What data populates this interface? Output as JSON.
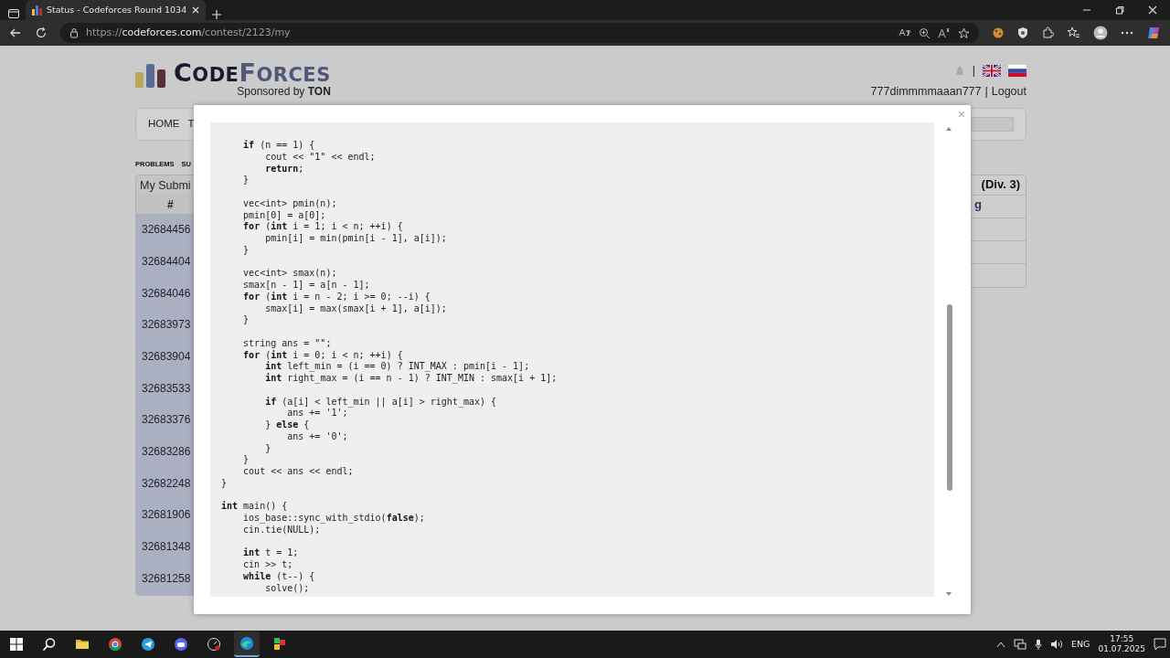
{
  "browser": {
    "tab": {
      "title": "Status - Codeforces Round 1034",
      "selected": true
    },
    "url": {
      "scheme": "https://",
      "host": "codeforces.com",
      "path": "/contest/2123/my"
    }
  },
  "page": {
    "logo": {
      "first": "CODE",
      "second": "FORCES",
      "sponsor": "Sponsored by **TON**"
    },
    "user": {
      "separator": "|",
      "handle": "777dimmmmaaan777",
      "between": "|",
      "logout": "Logout"
    },
    "menu": [
      {
        "label": "HOME"
      },
      {
        "label": "T"
      }
    ],
    "submenu": [
      {
        "label": "PROBLEMS"
      },
      {
        "label": "SU"
      }
    ],
    "submissions": {
      "title": "My Submi",
      "header": "#",
      "ids": [
        "32684456",
        "32684404",
        "32684046",
        "32683973",
        "32683904",
        "32683533",
        "32683376",
        "32683286",
        "32682248",
        "32681906",
        "32681348",
        "32681258"
      ]
    },
    "sidebar": {
      "title": "(Div. 3)",
      "link": "g"
    }
  },
  "modal": {
    "close": "×",
    "code_blocks": [
      [
        "    **if** (n == 1) {",
        "        cout << \"1\" << endl;",
        "        **return**;",
        "    }"
      ],
      [
        "    vec<int> pmin(n);",
        "    pmin[0] = a[0];",
        "    **for** (**int** i = 1; i < n; ++i) {",
        "        pmin[i] = min(pmin[i - 1], a[i]);",
        "    }"
      ],
      [
        "    vec<int> smax(n);",
        "    smax[n - 1] = a[n - 1];",
        "    **for** (**int** i = n - 2; i >= 0; --i) {",
        "        smax[i] = max(smax[i + 1], a[i]);",
        "    }"
      ],
      [
        "    string ans = \"\";",
        "    **for** (**int** i = 0; i < n; ++i) {",
        "        **int** left_min = (i == 0) ? INT_MAX : pmin[i - 1];",
        "        **int** right_max = (i == n - 1) ? INT_MIN : smax[i + 1];"
      ],
      [
        "        **if** (a[i] < left_min || a[i] > right_max) {",
        "            ans += '1';",
        "        } **else** {",
        "            ans += '0';",
        "        }",
        "    }",
        "    cout << ans << endl;",
        "}"
      ],
      [
        "**int** main() {",
        "    ios_base::sync_with_stdio(**false**);",
        "    cin.tie(NULL);"
      ],
      [
        "    **int** t = 1;",
        "    cin >> t;",
        "    **while** (t--) {",
        "        solve();"
      ]
    ]
  },
  "taskbar": {
    "language": "ENG",
    "time": "17:55",
    "date": "01.07.2025"
  }
}
